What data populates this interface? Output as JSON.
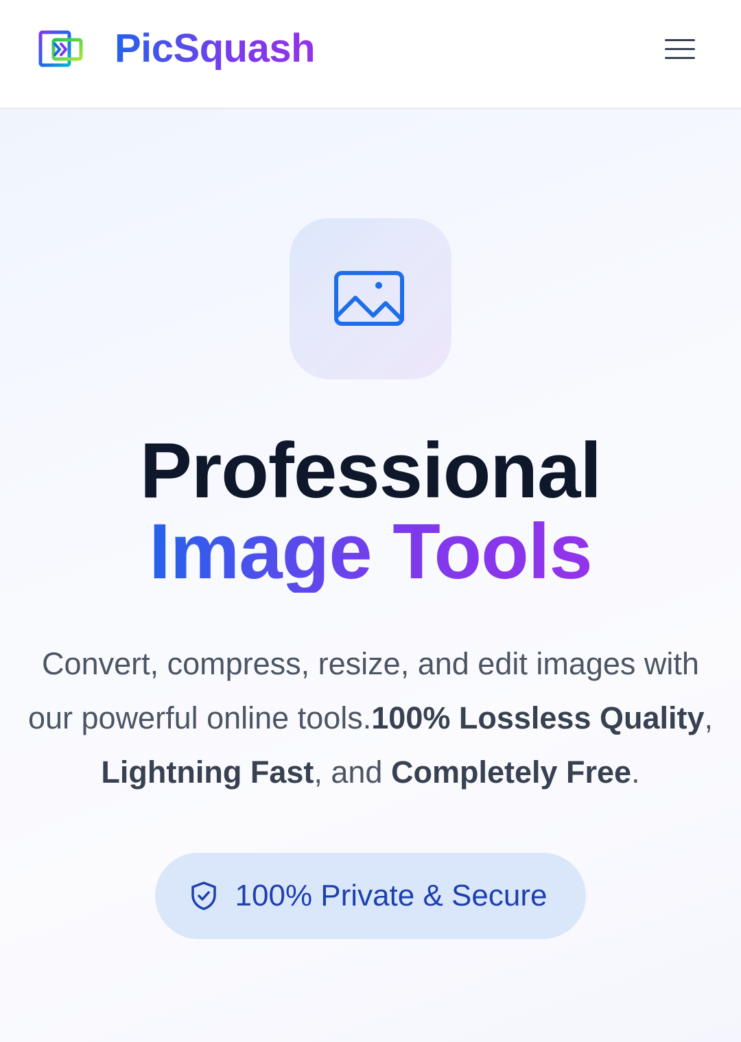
{
  "header": {
    "brand": "PicSquash",
    "logo_icon": "compress-arrows-icon",
    "menu_icon": "hamburger-menu-icon"
  },
  "hero": {
    "icon": "image-icon",
    "title_line1": "Professional",
    "title_line2": "Image Tools",
    "description": {
      "intro": "Convert, compress, resize, and edit images with our powerful online tools.",
      "highlight1": "100% Lossless Quality",
      "sep1": ", ",
      "highlight2": "Lightning Fast",
      "sep2": ", and ",
      "highlight3": "Completely Free",
      "end": "."
    },
    "badge": {
      "icon": "shield-check-icon",
      "label": "100% Private & Secure"
    }
  },
  "colors": {
    "brand_blue": "#2563eb",
    "brand_purple": "#9333ea",
    "title_dark": "#0f172a",
    "badge_bg": "#dae7fa",
    "badge_text": "#1e40af"
  }
}
